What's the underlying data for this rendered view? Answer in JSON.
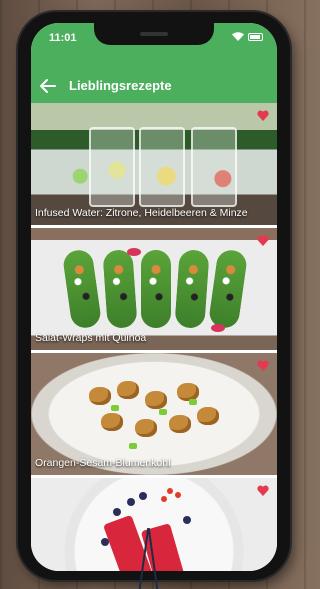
{
  "status_bar": {
    "time": "11:01"
  },
  "app_bar": {
    "title": "Lieblingsrezepte",
    "back_icon": "arrow-left-icon"
  },
  "recipes": [
    {
      "name": "Infused Water: Zitrone, Heidelbeeren & Minze",
      "favorite": true
    },
    {
      "name": "Salat-Wraps mit Quinoa",
      "favorite": true
    },
    {
      "name": "Orangen-Sesam-Blumenkohl",
      "favorite": true
    },
    {
      "name": "",
      "favorite": true
    }
  ],
  "colors": {
    "primary": "#4caf5e",
    "heart": "#e53950"
  }
}
